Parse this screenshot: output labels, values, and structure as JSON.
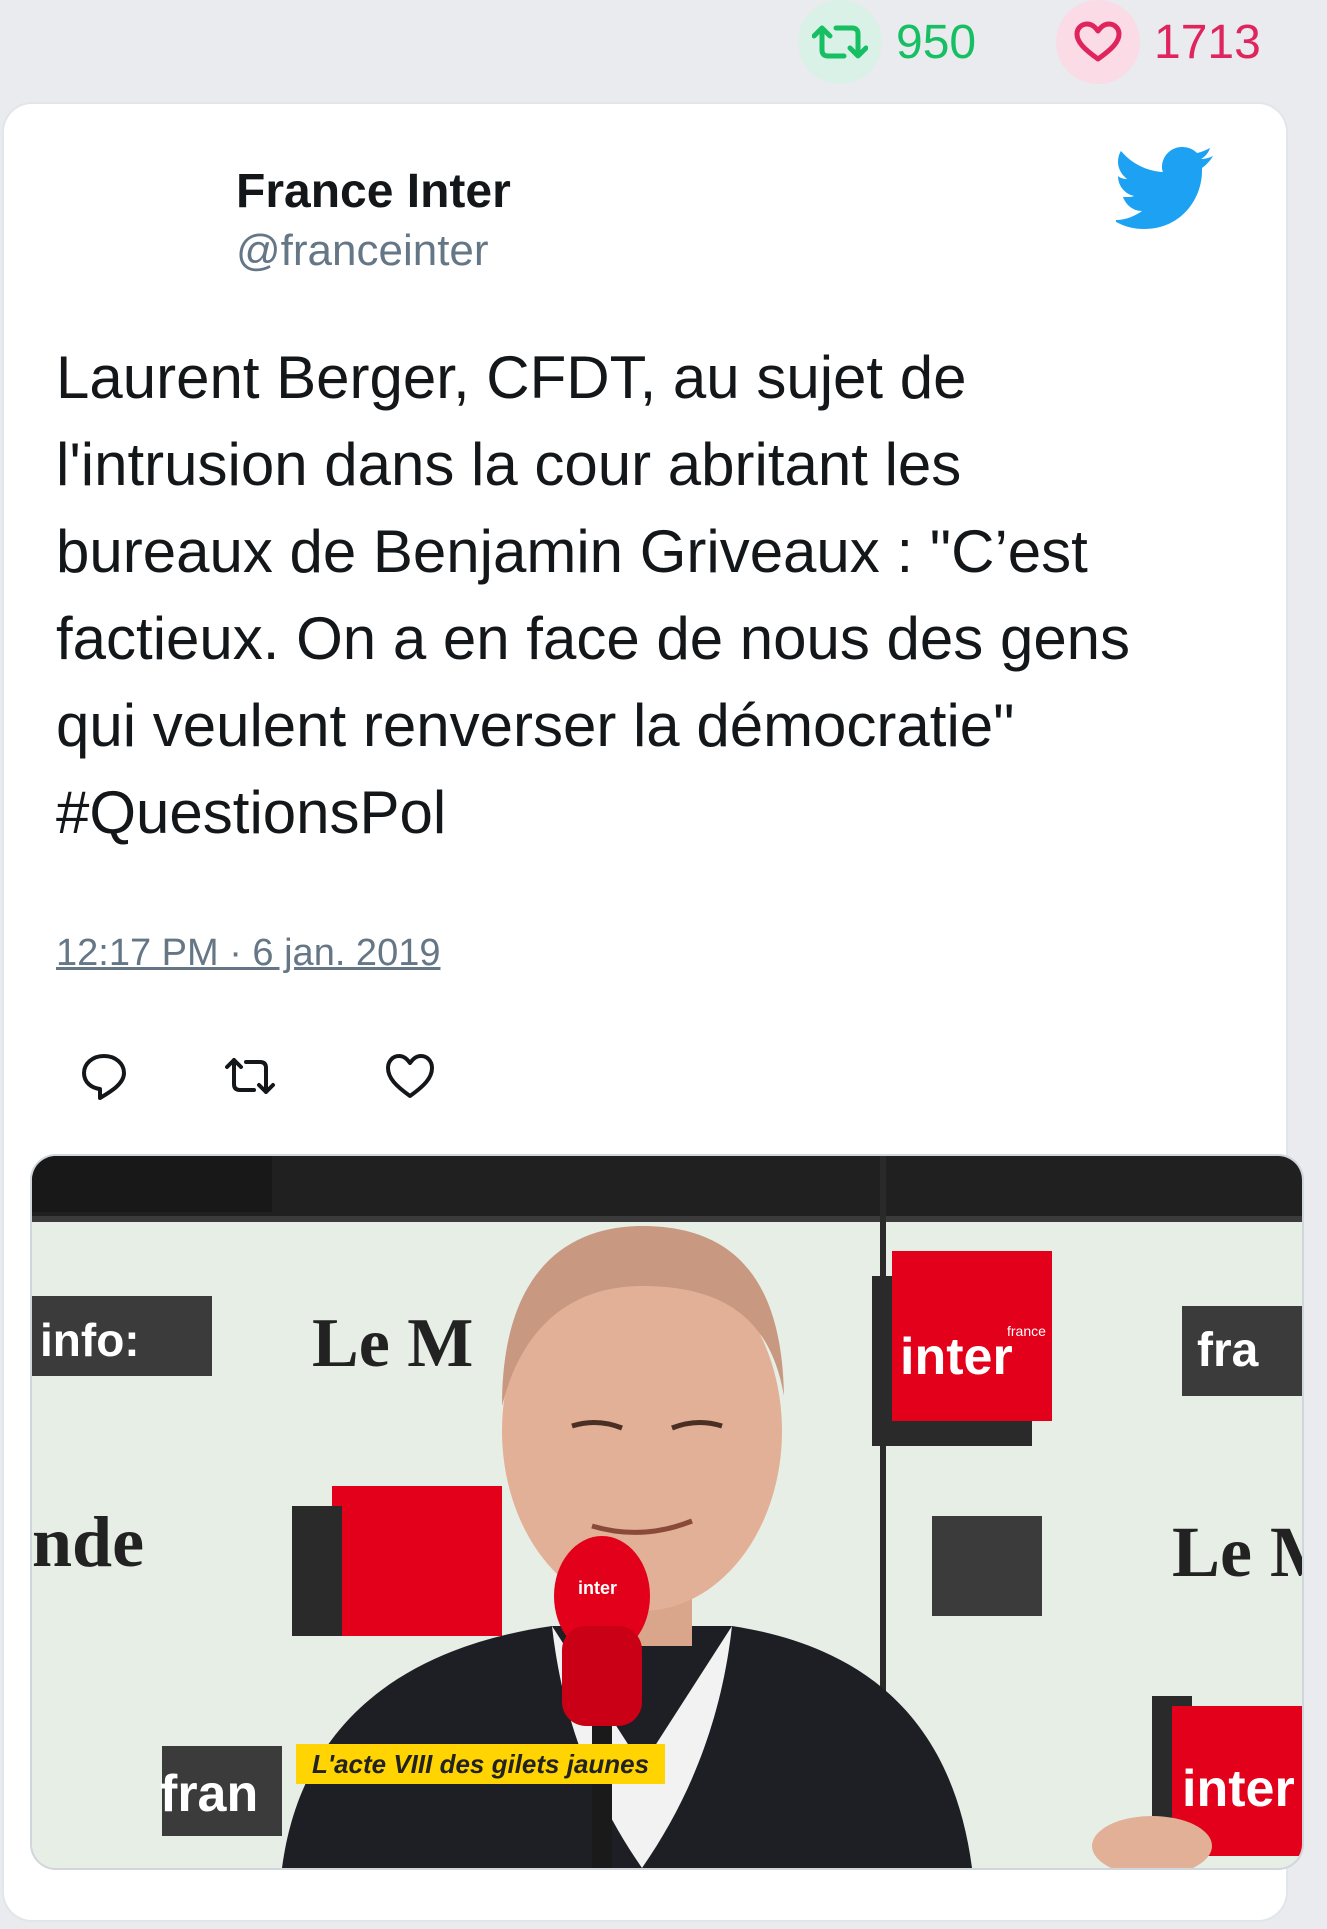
{
  "stats": {
    "retweet_count": "950",
    "like_count": "1713"
  },
  "tweet": {
    "author_name": "France Inter",
    "author_handle": "@franceinter",
    "text": "Laurent Berger, CFDT, au sujet de\nl'intrusion dans la cour abritant les\nbureaux de Benjamin Griveaux : \"C’est\nfactieux. On a en face de nous des gens\nqui veulent renverser la démocratie\"\n#QuestionsPol",
    "timestamp": "12:17 PM · 6 jan. 2019"
  },
  "media": {
    "caption": "L'acte VIII des gilets jaunes",
    "logos": {
      "inter_top": "inter",
      "inter_bottom": "inter",
      "france_small": "france",
      "info_left": "info:",
      "le_monde_left": "Le M",
      "le_monde_right": "Le M",
      "monde_left": "nde",
      "fra_right": "fra",
      "fran_left": "fran",
      "mic_label": "inter"
    }
  },
  "icons": {
    "retweet": "retweet-icon",
    "like": "heart-icon",
    "reply": "reply-icon",
    "brand": "twitter-bird-icon"
  },
  "colors": {
    "retweet_green": "#17bf63",
    "like_pink": "#e0245e",
    "twitter_blue": "#1da1f2",
    "text_dark": "#14171a",
    "text_grey": "#657786",
    "inter_red": "#e2001a"
  }
}
